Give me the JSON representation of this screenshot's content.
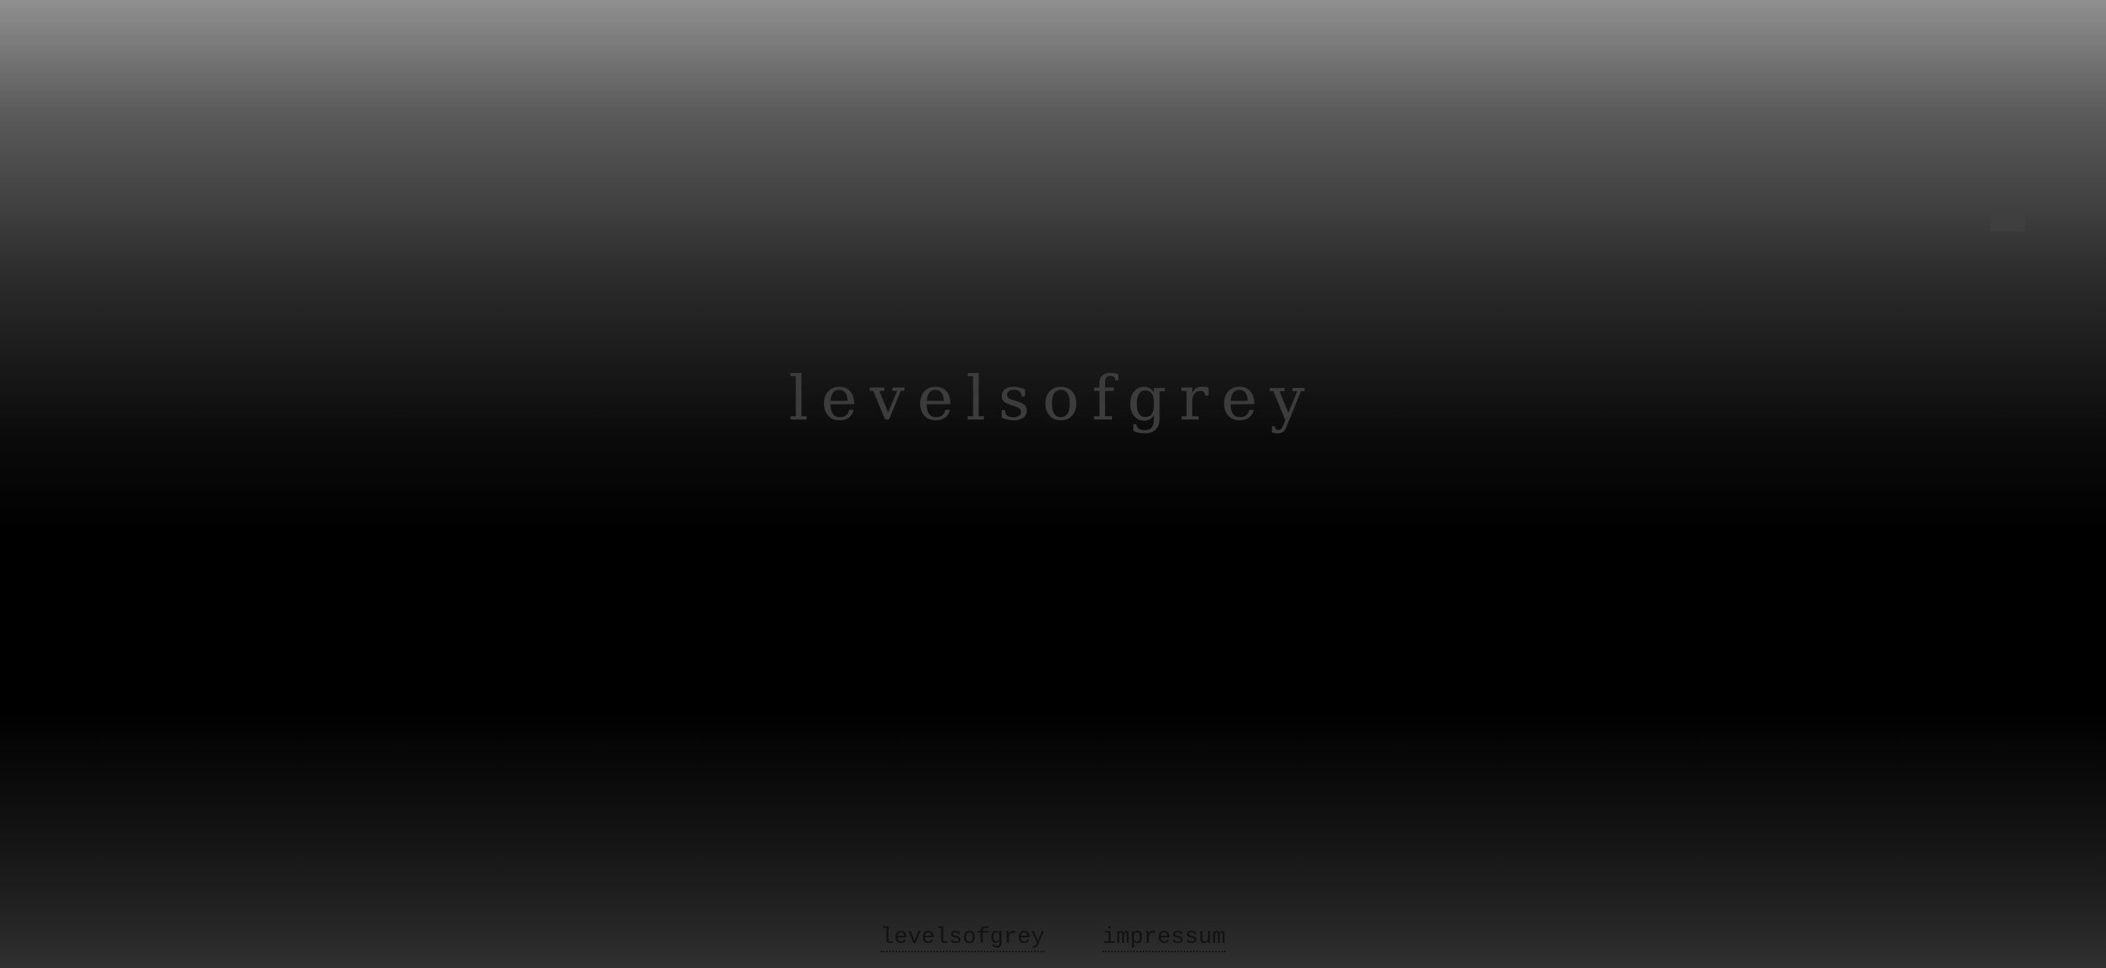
{
  "brand": {
    "logo_text": "levelsofgrey"
  },
  "footer": {
    "links": [
      {
        "label": "levelsofgrey"
      },
      {
        "label": "impressum"
      }
    ]
  },
  "colors": {
    "gradient_top": "#8f8f8f",
    "gradient_middle": "#000000",
    "gradient_bottom": "#303030",
    "logo_text": "#3c3c3c",
    "footer_link": "#121212"
  }
}
